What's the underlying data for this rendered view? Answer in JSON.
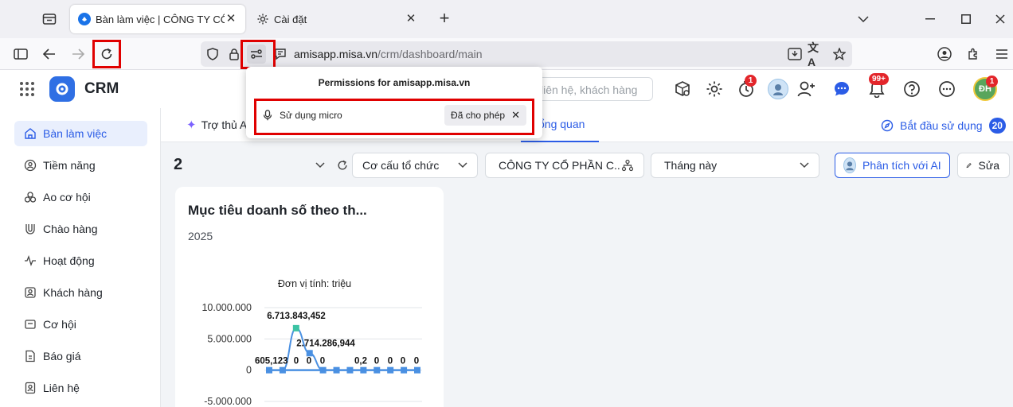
{
  "browser": {
    "tabs": [
      {
        "title": "Bàn làm việc | CÔNG TY CỔ PHẦN",
        "active": true
      },
      {
        "title": "Cài đặt",
        "active": false
      }
    ],
    "url_domain": "amisapp.misa.vn",
    "url_path": "/crm/dashboard/main",
    "permissions_popup": {
      "title": "Permissions for amisapp.misa.vn",
      "item_label": "Sử dụng micro",
      "item_status": "Đã cho phép"
    }
  },
  "app": {
    "brand": "CRM",
    "search_placeholder": "liên hệ, khách hàng",
    "badges": {
      "timer": "1",
      "notifications": "99+",
      "avatar": "1"
    },
    "user_initials": "ĐH"
  },
  "sidebar": {
    "items": [
      {
        "label": "Bàn làm việc",
        "icon": "home-icon",
        "active": true
      },
      {
        "label": "Tiềm năng",
        "icon": "prospect-icon"
      },
      {
        "label": "Ao cơ hội",
        "icon": "pool-icon"
      },
      {
        "label": "Chào hàng",
        "icon": "offer-icon"
      },
      {
        "label": "Hoạt động",
        "icon": "activity-icon"
      },
      {
        "label": "Khách hàng",
        "icon": "customer-icon"
      },
      {
        "label": "Cơ hội",
        "icon": "opportunity-icon"
      },
      {
        "label": "Báo giá",
        "icon": "quote-icon"
      },
      {
        "label": "Liên hệ",
        "icon": "contact-icon"
      }
    ]
  },
  "main": {
    "assistant_label": "Trợ thủ A",
    "overview_tab": "ổng quan",
    "get_started_label": "Bắt đầu sử dụng",
    "get_started_count": "20",
    "page_number": "2",
    "filters": {
      "org_structure": "Cơ cấu tổ chức",
      "company": "CÔNG TY CỔ PHẦN C...",
      "period": "Tháng này",
      "ai_button": "Phân tích với AI",
      "edit_button": "Sửa"
    },
    "card": {
      "title": "Mục tiêu doanh số theo th...",
      "year": "2025",
      "unit": "Đơn vị tính: triệu"
    }
  },
  "colors": {
    "accent": "#2b5ce6",
    "badge": "#e3262b",
    "highlight_box": "#e00000",
    "series_line": "#4a90e2",
    "series_marker_teal": "#3cc3a4"
  },
  "chart_data": {
    "type": "line",
    "ylim": [
      -5000000,
      10000000
    ],
    "y_ticks": [
      "10.000.000",
      "5.000.000",
      "0",
      "-5.000.000"
    ],
    "series": [
      {
        "values": [
          0,
          0,
          6713843.452,
          2714286.944,
          0,
          0,
          0,
          0,
          0,
          0,
          0,
          0
        ]
      }
    ],
    "data_labels": [
      "605,123",
      "6.713.843,452",
      "2.714.286,944",
      "0",
      "0",
      "0",
      "0,2",
      "0",
      "0",
      "0",
      "0"
    ]
  }
}
